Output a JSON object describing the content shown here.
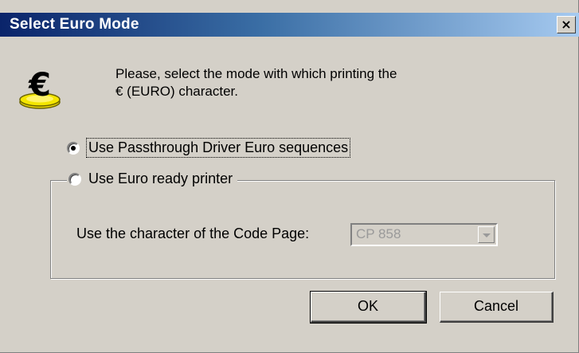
{
  "window": {
    "title": "Select Euro Mode",
    "close_glyph": "×"
  },
  "icon": {
    "name": "euro-coin-icon",
    "glyph": "€",
    "coin_color": "#e8d400"
  },
  "prompt": {
    "line1": "Please, select the mode with which printing the",
    "line2": "€ (EURO) character."
  },
  "options": {
    "passthrough": {
      "label": "Use Passthrough Driver Euro sequences",
      "checked": true
    },
    "euro_ready": {
      "label": "Use Euro ready printer",
      "checked": false
    }
  },
  "codepage": {
    "label": "Use the character of the Code Page:",
    "selected": "CP 858",
    "enabled": false
  },
  "buttons": {
    "ok": "OK",
    "cancel": "Cancel"
  }
}
